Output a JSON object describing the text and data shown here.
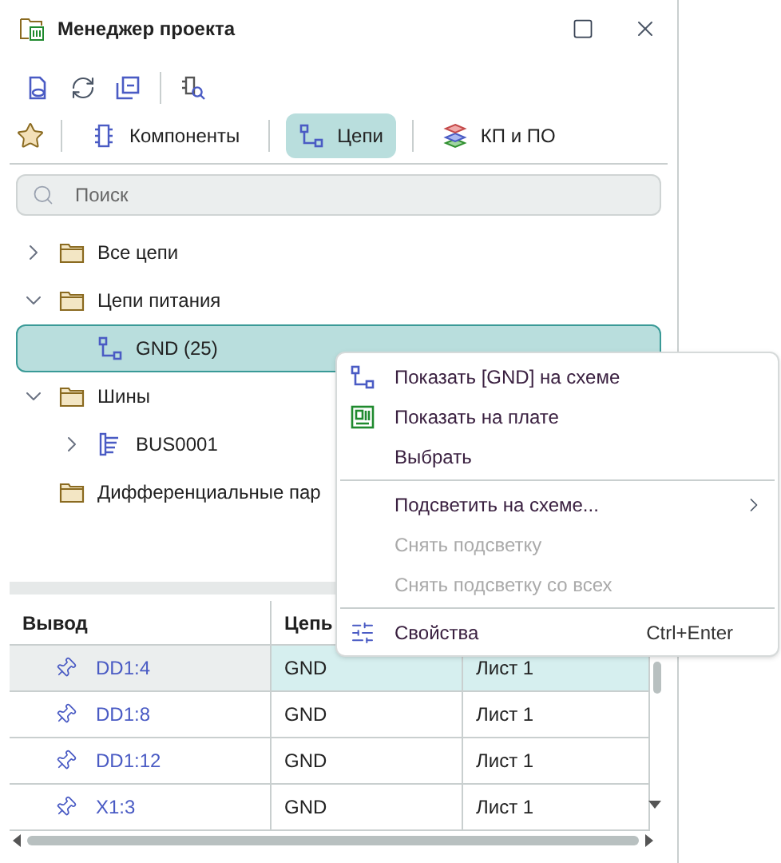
{
  "window": {
    "title": "Менеджер проекта"
  },
  "tabs": [
    {
      "label": "Компоненты",
      "kind": "chip",
      "selected": false
    },
    {
      "label": "Цепи",
      "kind": "net",
      "selected": true
    },
    {
      "label": "КП и ПО",
      "kind": "layers",
      "selected": false
    }
  ],
  "search": {
    "placeholder": "Поиск"
  },
  "tree": [
    {
      "label": "Все цепи",
      "kind": "folder",
      "expanded": false,
      "selected": false
    },
    {
      "label": "Цепи питания",
      "kind": "folder",
      "expanded": true,
      "selected": false,
      "children": [
        {
          "label": "GND (25)",
          "kind": "net",
          "selected": true
        }
      ]
    },
    {
      "label": "Шины",
      "kind": "folder",
      "expanded": true,
      "selected": false,
      "children": [
        {
          "label": "BUS0001",
          "kind": "bus",
          "expanded": false,
          "selected": false
        }
      ]
    },
    {
      "label": "Дифференциальные пар",
      "kind": "folder",
      "selected": false
    }
  ],
  "table": {
    "columns": [
      "Вывод",
      "Цепь"
    ],
    "rows": [
      {
        "cells": [
          "DD1:4",
          "GND",
          "Лист 1"
        ],
        "selected": true
      },
      {
        "cells": [
          "DD1:8",
          "GND",
          "Лист 1"
        ],
        "selected": false
      },
      {
        "cells": [
          "DD1:12",
          "GND",
          "Лист 1"
        ],
        "selected": false
      },
      {
        "cells": [
          "X1:3",
          "GND",
          "Лист 1"
        ],
        "selected": false
      }
    ]
  },
  "context_menu": [
    {
      "kind": "net",
      "label": "Показать [GND] на схеме",
      "disabled": false
    },
    {
      "kind": "board",
      "label": "Показать на плате",
      "disabled": false
    },
    {
      "kind": "item",
      "label": "Выбрать",
      "disabled": false
    },
    {
      "kind": "separator"
    },
    {
      "kind": "item",
      "label": "Подсветить на схеме...",
      "disabled": false,
      "submenu": true
    },
    {
      "kind": "item",
      "label": "Снять подсветку",
      "disabled": true
    },
    {
      "kind": "item",
      "label": "Снять подсветку со всех",
      "disabled": true
    },
    {
      "kind": "separator"
    },
    {
      "kind": "sliders",
      "label": "Свойства",
      "disabled": false,
      "shortcut": "Ctrl+Enter"
    }
  ]
}
